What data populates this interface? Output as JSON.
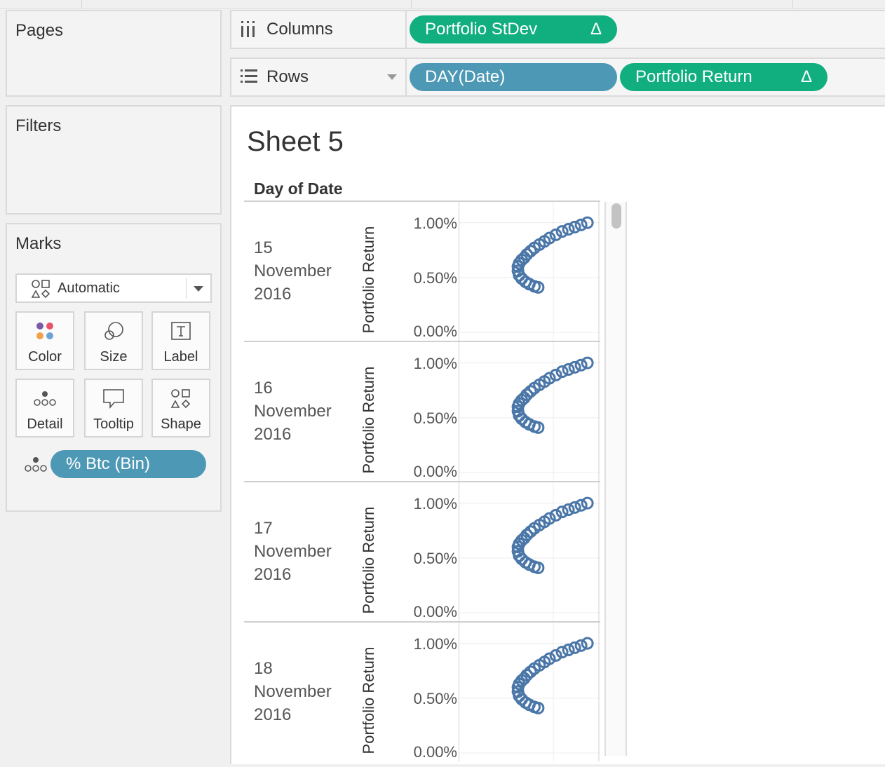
{
  "left": {
    "pages_title": "Pages",
    "filters_title": "Filters",
    "marks": {
      "title": "Marks",
      "mark_type": "Automatic",
      "buttons": [
        {
          "label": "Color",
          "icon": "color-icon"
        },
        {
          "label": "Size",
          "icon": "size-icon"
        },
        {
          "label": "Label",
          "icon": "label-icon"
        },
        {
          "label": "Detail",
          "icon": "detail-icon"
        },
        {
          "label": "Tooltip",
          "icon": "tooltip-icon"
        },
        {
          "label": "Shape",
          "icon": "shape-icon"
        }
      ],
      "detail_pill": "% Btc (Bin)"
    }
  },
  "shelves": {
    "columns_label": "Columns",
    "columns_pills": [
      {
        "label": "Portfolio StDev",
        "delta": "Δ"
      }
    ],
    "rows_label": "Rows",
    "rows_pills": [
      {
        "label": "DAY(Date)",
        "delta": ""
      },
      {
        "label": "Portfolio Return",
        "delta": "Δ"
      }
    ]
  },
  "colors": {
    "dimension_pill": "#4d98b4",
    "measure_pill": "#11af7f",
    "mark": "#4a76a8"
  },
  "sheet": {
    "title": "Sheet 5",
    "row_header": "Day of Date",
    "y_axis_title": "Portfolio Return",
    "y_ticks": [
      "1.00%",
      "0.50%",
      "0.00%"
    ],
    "panels": [
      {
        "day": "15",
        "month": "November",
        "year": "2016"
      },
      {
        "day": "16",
        "month": "November",
        "year": "2016"
      },
      {
        "day": "17",
        "month": "November",
        "year": "2016"
      },
      {
        "day": "18",
        "month": "November",
        "year": "2016"
      }
    ]
  },
  "chart_data": {
    "type": "scatter",
    "ylabel": "Portfolio Return",
    "yticks": [
      "1.00%",
      "0.50%",
      "0.00%"
    ],
    "ylim": [
      0,
      1.1
    ],
    "xlim": [
      0,
      1
    ],
    "mark_shape": "circle-open",
    "series": [
      {
        "name": "",
        "points": [
          [
            0.42,
            0.6
          ],
          [
            0.43,
            0.63
          ],
          [
            0.45,
            0.66
          ],
          [
            0.47,
            0.68
          ],
          [
            0.49,
            0.71
          ],
          [
            0.52,
            0.74
          ],
          [
            0.55,
            0.77
          ],
          [
            0.59,
            0.8
          ],
          [
            0.63,
            0.83
          ],
          [
            0.67,
            0.86
          ],
          [
            0.72,
            0.89
          ],
          [
            0.77,
            0.92
          ],
          [
            0.82,
            0.94
          ],
          [
            0.87,
            0.96
          ],
          [
            0.92,
            0.98
          ],
          [
            0.97,
            1.0
          ],
          [
            0.42,
            0.56
          ],
          [
            0.43,
            0.52
          ],
          [
            0.45,
            0.49
          ],
          [
            0.48,
            0.46
          ],
          [
            0.51,
            0.44
          ],
          [
            0.55,
            0.42
          ],
          [
            0.58,
            0.41
          ]
        ]
      }
    ]
  }
}
